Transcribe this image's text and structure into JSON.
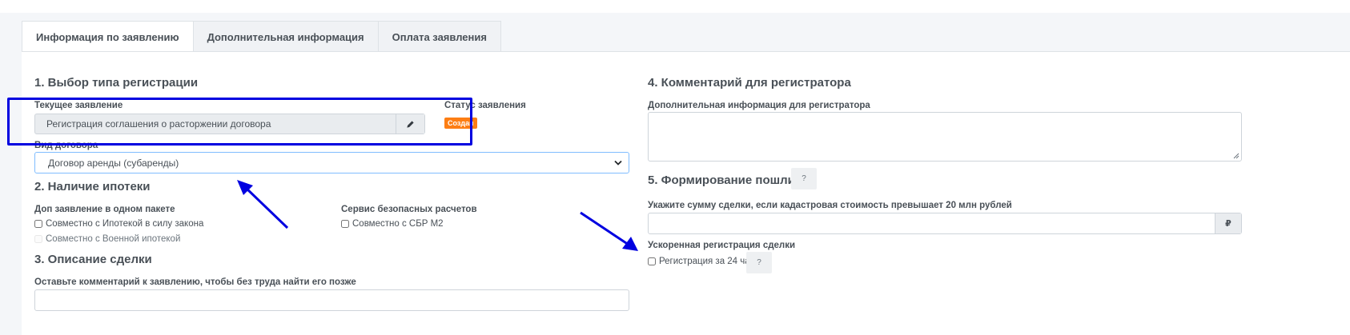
{
  "tabs": [
    {
      "label": "Информация по заявлению"
    },
    {
      "label": "Дополнительная информация"
    },
    {
      "label": "Оплата заявления"
    }
  ],
  "section1": {
    "title": "1. Выбор типа регистрации",
    "current_label": "Текущее заявление",
    "current_value": "Регистрация соглашения о расторжении договора",
    "status_label": "Статус заявления",
    "status_badge": "Создан",
    "contract_type_label": "Вид договора",
    "contract_type_value": "Договор аренды (субаренды)"
  },
  "section2": {
    "title": "2. Наличие ипотеки",
    "package_label": "Доп заявление в одном пакете",
    "opt1": "Совместно с Ипотекой в силу закона",
    "opt2": "Совместно с Военной ипотекой",
    "safe_label": "Сервис безопасных расчетов",
    "opt3": "Совместно с СБР М2"
  },
  "section3": {
    "title": "3. Описание сделки",
    "comment_label": "Оставьте комментарий к заявлению, чтобы без труда найти его позже",
    "comment_value": ""
  },
  "section4": {
    "title": "4. Комментарий для регистратора",
    "info_label": "Дополнительная информация для регистратора",
    "info_value": ""
  },
  "section5": {
    "title": "5. Формирование пошлины",
    "help": "?",
    "sum_label": "Укажите сумму сделки, если кадастровая стоимость превышает 20 млн рублей",
    "sum_value": "",
    "currency": "₽",
    "fast_label": "Ускоренная регистрация сделки",
    "fast_opt": "Регистрация за 24 часа",
    "fast_help": "?"
  },
  "colors": {
    "annotation": "#0000e0",
    "status_badge": "#fd7e14",
    "focus_border": "#80bdff"
  },
  "icons": {
    "edit": "pencil-icon",
    "dropdown": "chevron-down-icon",
    "currency": "ruble-icon",
    "resize": "resize-grip-icon"
  }
}
